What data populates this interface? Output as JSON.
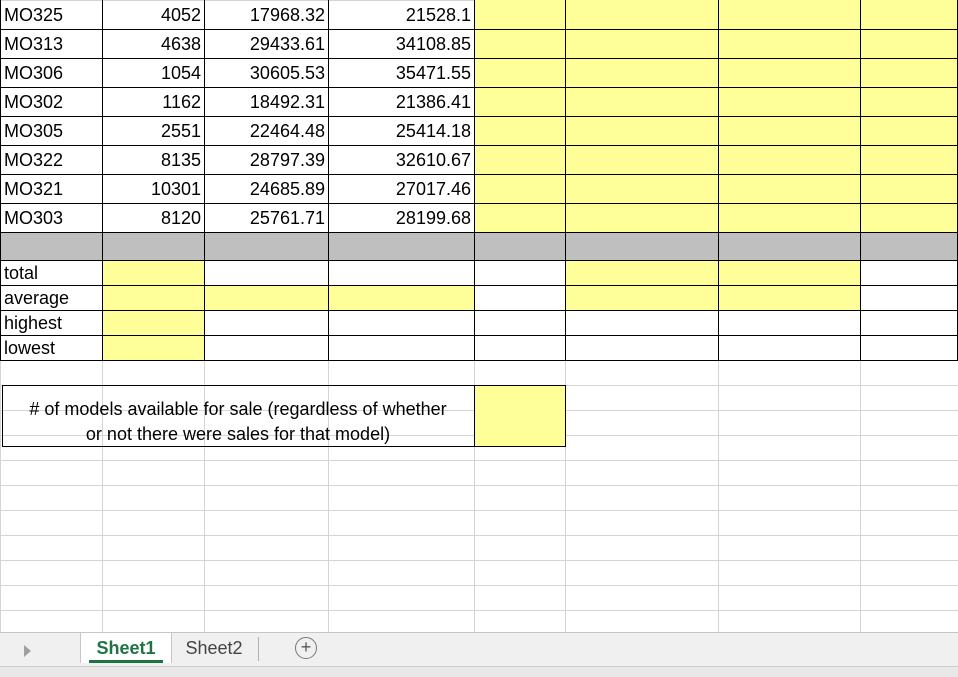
{
  "rows": [
    {
      "model": "MO325",
      "units": "4052",
      "c": "17968.32",
      "d": "21528.1"
    },
    {
      "model": "MO313",
      "units": "4638",
      "c": "29433.61",
      "d": "34108.85"
    },
    {
      "model": "MO306",
      "units": "1054",
      "c": "30605.53",
      "d": "35471.55"
    },
    {
      "model": "MO302",
      "units": "1162",
      "c": "18492.31",
      "d": "21386.41"
    },
    {
      "model": "MO305",
      "units": "2551",
      "c": "22464.48",
      "d": "25414.18"
    },
    {
      "model": "MO322",
      "units": "8135",
      "c": "28797.39",
      "d": "32610.67"
    },
    {
      "model": "MO321",
      "units": "10301",
      "c": "24685.89",
      "d": "27017.46"
    },
    {
      "model": "MO303",
      "units": "8120",
      "c": "25761.71",
      "d": "28199.68"
    }
  ],
  "summary": {
    "total": " total",
    "average": "average",
    "highest": "highest",
    "lowest": "lowest"
  },
  "note": {
    "line1": "# of models available for sale (regardless of whether",
    "line2": "or not there were sales for that model)"
  },
  "tabs": {
    "sheet1": "Sheet1",
    "sheet2": "Sheet2",
    "add": "+"
  },
  "colors": {
    "highlight": "#ffff99",
    "separator_row": "#bfbfbf",
    "active_tab_text": "#217346"
  }
}
